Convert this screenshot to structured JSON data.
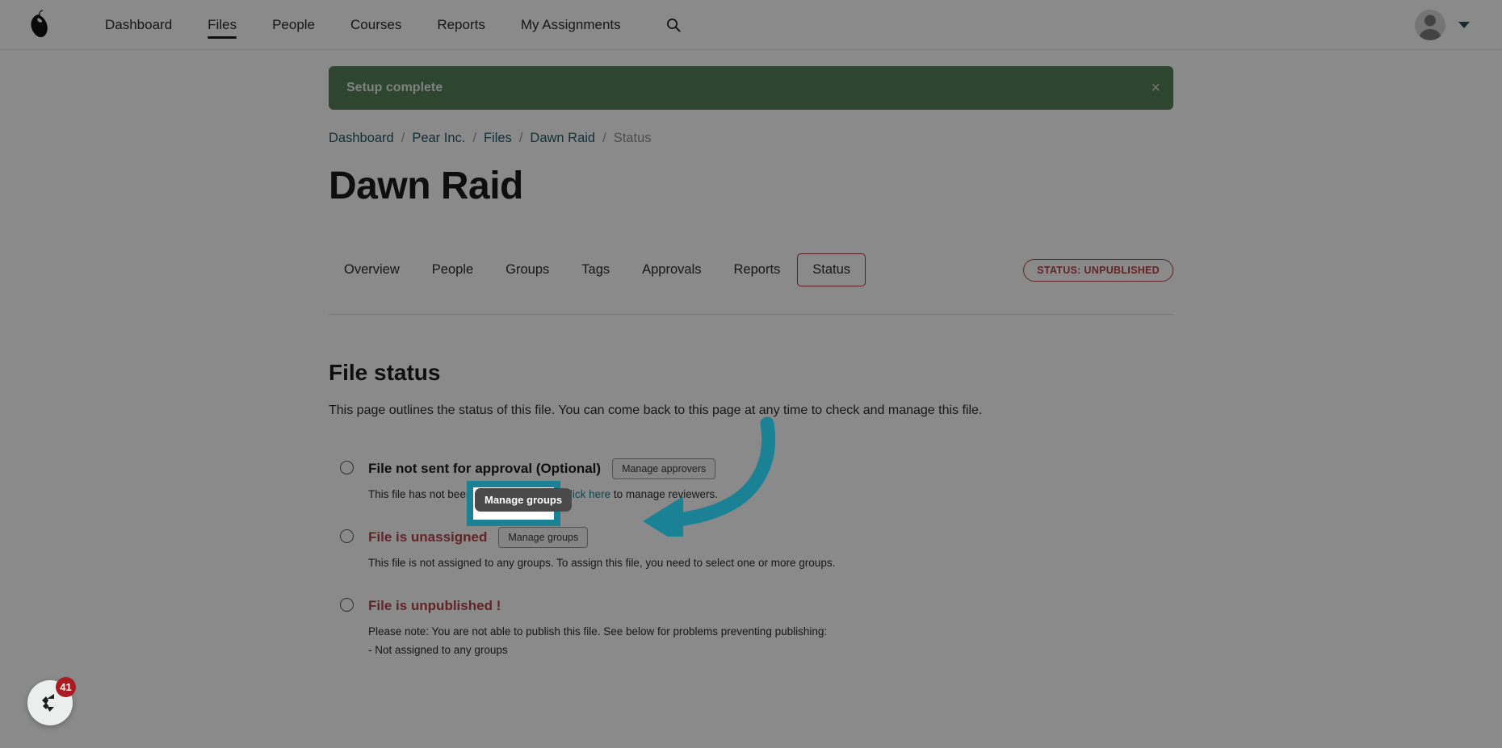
{
  "navbar": {
    "logo_icon": "pear-logo-icon",
    "links": [
      {
        "label": "Dashboard",
        "active": false
      },
      {
        "label": "Files",
        "active": true
      },
      {
        "label": "People",
        "active": false
      },
      {
        "label": "Courses",
        "active": false
      },
      {
        "label": "Reports",
        "active": false
      },
      {
        "label": "My Assignments",
        "active": false
      }
    ],
    "search_icon": "search-icon",
    "avatar_icon": "user-avatar-icon",
    "caret_icon": "chevron-down-icon"
  },
  "alert": {
    "message": "Setup complete",
    "close_label": "×",
    "color": "#55805a"
  },
  "breadcrumb": {
    "items": [
      {
        "label": "Dashboard",
        "current": false
      },
      {
        "label": "Pear Inc.",
        "current": false
      },
      {
        "label": "Files",
        "current": false
      },
      {
        "label": "Dawn Raid",
        "current": false
      },
      {
        "label": "Status",
        "current": true
      }
    ],
    "separator": "/"
  },
  "page": {
    "title": "Dawn Raid"
  },
  "tabs": {
    "items": [
      {
        "label": "Overview",
        "active": false
      },
      {
        "label": "People",
        "active": false
      },
      {
        "label": "Groups",
        "active": false
      },
      {
        "label": "Tags",
        "active": false
      },
      {
        "label": "Approvals",
        "active": false
      },
      {
        "label": "Reports",
        "active": false
      },
      {
        "label": "Status",
        "active": true
      }
    ],
    "status_badge": "STATUS: UNPUBLISHED",
    "status_badge_color": "#b3444a"
  },
  "file_status": {
    "heading": "File status",
    "description": "This page outlines the status of this file. You can come back to this page at any time to check and manage this file.",
    "items": [
      {
        "label": "File not sent for approval (Optional)",
        "danger": false,
        "button": "Manage approvers",
        "sub_pre": "This file has not been sent for approval. ",
        "sub_link": "Click here",
        "sub_post": " to manage reviewers.",
        "extra": ""
      },
      {
        "label": "File is unassigned",
        "danger": true,
        "button": "Manage groups",
        "sub_pre": "This file is not assigned to any groups. To assign this file, you need to select one or more groups.",
        "sub_link": "",
        "sub_post": "",
        "extra": ""
      },
      {
        "label": "File is unpublished !",
        "danger": true,
        "button": "",
        "sub_pre": "Please note: You are not able to publish this file. See below for problems preventing publishing:",
        "sub_link": "",
        "sub_post": "",
        "extra": "- Not assigned to any groups"
      }
    ]
  },
  "highlight": {
    "tooltip_text": "Manage groups",
    "border_color": "#1b8296",
    "arrow_color": "#1b8296"
  },
  "chat_widget": {
    "icon": "chat-bubble-icon",
    "badge_count": "41",
    "badge_color": "#a81b21"
  }
}
